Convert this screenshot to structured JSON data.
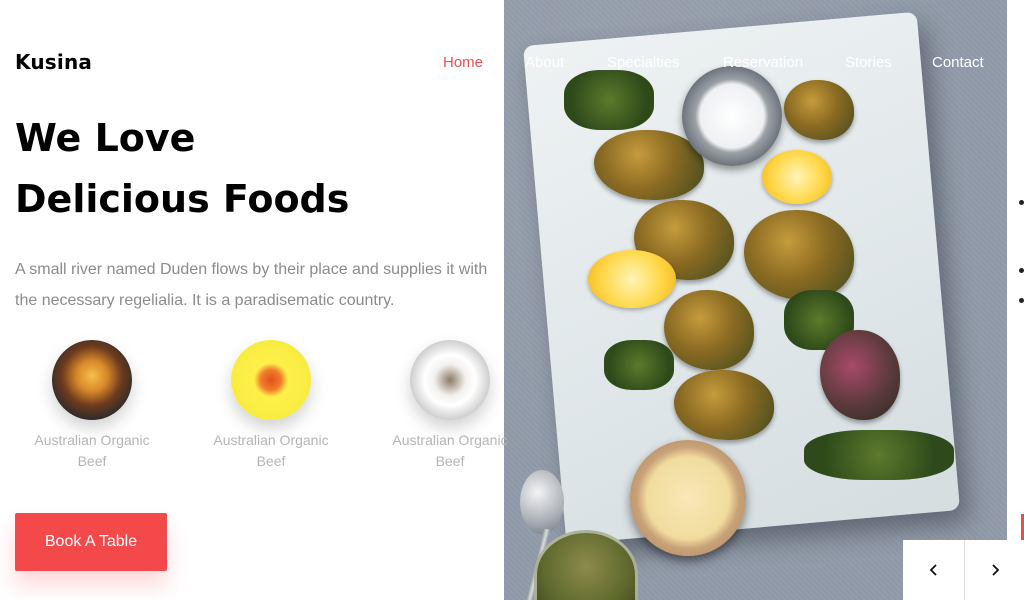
{
  "brand": {
    "name": "Kusina"
  },
  "nav": {
    "items": [
      {
        "label": "Home",
        "active": true
      },
      {
        "label": "About"
      },
      {
        "label": "Specialties"
      },
      {
        "label": "Reservation"
      },
      {
        "label": "Stories"
      },
      {
        "label": "Contact"
      }
    ]
  },
  "hero": {
    "headline_line1": "We Love",
    "headline_line2": "Delicious Foods",
    "desc_line1": "A small river named Duden flows by their place and supplies it with",
    "desc_line2": "the necessary regelialia. It is a paradisematic country."
  },
  "dishes": [
    {
      "name_line1": "Australian Organic",
      "name_line2": "Beef"
    },
    {
      "name_line1": "Australian Organic",
      "name_line2": "Beef"
    },
    {
      "name_line1": "Australian Organic",
      "name_line2": "Beef"
    }
  ],
  "cta": {
    "book_label": "Book A Table"
  },
  "slider": {
    "prev_icon": "chevron-left-icon",
    "next_icon": "chevron-right-icon"
  },
  "colors": {
    "accent": "#f4494b",
    "nav_active": "#f04e4e",
    "nav_text": "#ffffff",
    "muted_text": "#8b8b8b"
  }
}
